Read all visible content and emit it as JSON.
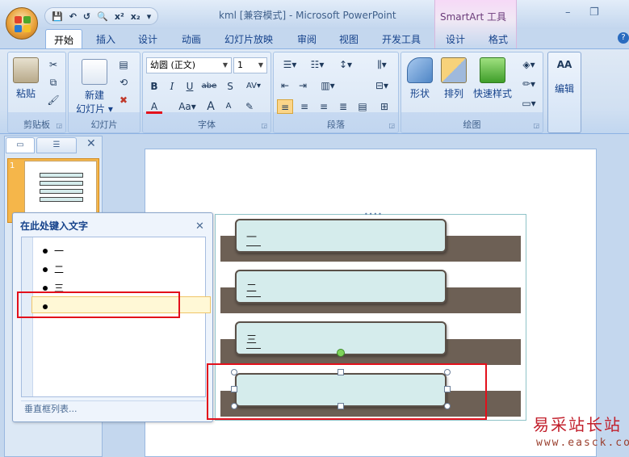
{
  "titlebar": {
    "title": "kml [兼容模式] - Microsoft PowerPoint",
    "contextual_label": "SmartArt 工具",
    "qat": [
      "💾",
      "↶",
      "↺",
      "🔍",
      "x²",
      "x₂",
      "▾"
    ],
    "window_controls": [
      "–",
      "❐"
    ]
  },
  "tabs": {
    "items": [
      "开始",
      "插入",
      "设计",
      "动画",
      "幻灯片放映",
      "审阅",
      "视图",
      "开发工具",
      "设计",
      "格式"
    ],
    "help": "?"
  },
  "ribbon": {
    "clipboard": {
      "label": "剪贴板",
      "paste": "粘贴"
    },
    "slides": {
      "label": "幻灯片",
      "new_slide_line1": "新建",
      "new_slide_line2": "幻灯片 ▾"
    },
    "font": {
      "label": "字体",
      "font_name": "幼圆 (正文)",
      "font_size": "1",
      "buttons": [
        "B",
        "I",
        "U",
        "abe",
        "S",
        "AV▾",
        "A",
        "Aa▾",
        "A",
        "A",
        "✎"
      ]
    },
    "paragraph": {
      "label": "段落"
    },
    "drawing": {
      "label": "绘图",
      "shapes": "形状",
      "arrange": "排列",
      "quick_styles": "快速样式"
    },
    "editing": {
      "label": "编辑",
      "icon_text": "AA"
    }
  },
  "slides_pane": {
    "slide_number": "1",
    "close": "✕"
  },
  "text_pane": {
    "title": "在此处键入文字",
    "close": "✕",
    "items": [
      "一",
      "二",
      "三",
      ""
    ],
    "footer": "垂直框列表..."
  },
  "smartart": {
    "boxes": [
      "一",
      "二",
      "三",
      ""
    ]
  },
  "watermark": {
    "main": "易采站长站",
    "sub": "www.easck.com"
  },
  "colors": {
    "accent": "#15428b",
    "highlight_red": "#e3101b",
    "band": "#6d6055",
    "box_fill": "#d5ecec"
  }
}
